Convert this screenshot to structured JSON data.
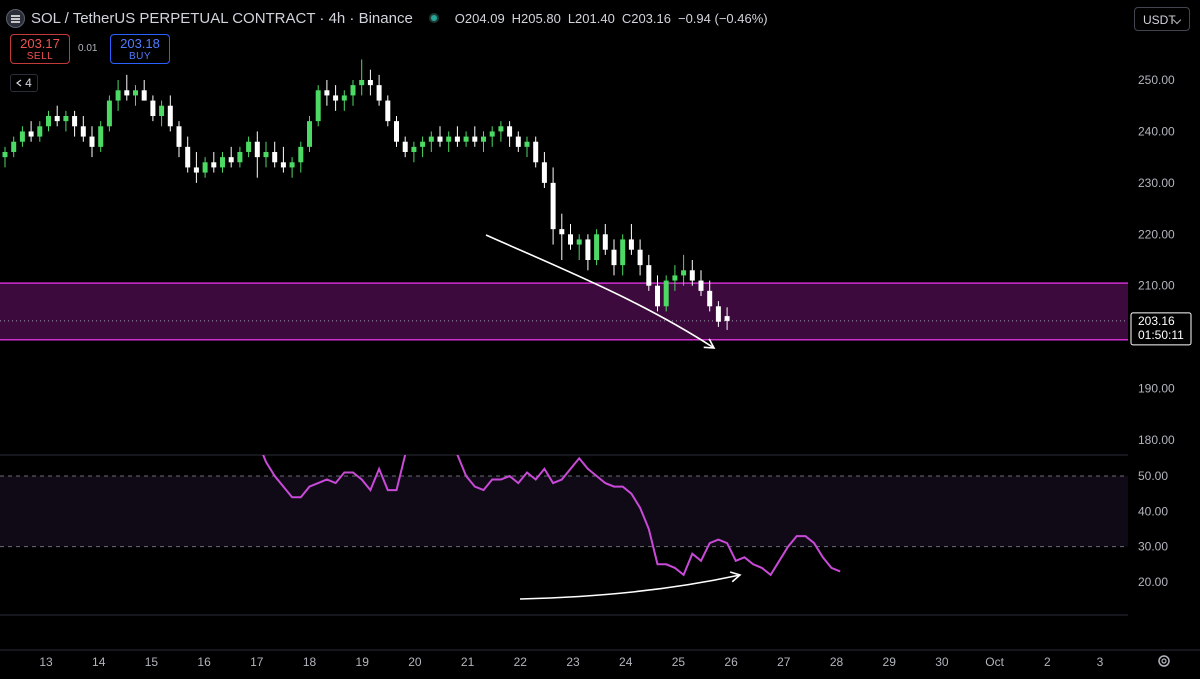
{
  "header": {
    "symbol": "SOL / TetherUS PERPETUAL CONTRACT · 4h · Binance",
    "open": "O204.09",
    "high": "H205.80",
    "low": "L201.40",
    "close": "C203.16",
    "change": "−0.94 (−0.46%)",
    "sell_price": "203.17",
    "sell_label": "SELL",
    "spread": "0.01",
    "buy_price": "203.18",
    "buy_label": "BUY",
    "collapse_count": "4",
    "currency": "USDT",
    "collapse_icon": "chevron-left-icon",
    "settings_icon": "gear-icon"
  },
  "chart_data": [
    {
      "type": "candlestick",
      "ylim": [
        175,
        255
      ],
      "yticks": [
        "250.00",
        "240.00",
        "230.00",
        "220.00",
        "210.00",
        "190.00",
        "180.00"
      ],
      "xticks": [
        "13",
        "14",
        "15",
        "16",
        "17",
        "18",
        "19",
        "20",
        "21",
        "22",
        "23",
        "24",
        "25",
        "26",
        "27",
        "28",
        "29",
        "30",
        "Oct",
        "2",
        "3"
      ],
      "last_price": "203.16",
      "countdown": "01:50:11",
      "colors": {
        "up": "#4cd964",
        "down": "#ffffff",
        "zone": "#d02fd0",
        "zone_fill": "#3c0a3c"
      },
      "zone": [
        199.5,
        210.5
      ],
      "candles": [
        [
          235,
          237,
          233,
          236
        ],
        [
          236,
          239,
          235,
          238
        ],
        [
          238,
          241,
          237,
          240
        ],
        [
          240,
          242,
          238,
          239
        ],
        [
          239,
          242,
          238,
          241
        ],
        [
          241,
          244,
          240,
          243
        ],
        [
          243,
          245,
          241,
          242
        ],
        [
          242,
          244,
          240,
          243
        ],
        [
          243,
          244,
          239,
          241
        ],
        [
          241,
          243,
          238,
          239
        ],
        [
          239,
          241,
          235,
          237
        ],
        [
          237,
          242,
          236,
          241
        ],
        [
          241,
          247,
          240,
          246
        ],
        [
          246,
          250,
          244,
          248
        ],
        [
          248,
          251,
          246,
          247
        ],
        [
          247,
          249,
          245,
          248
        ],
        [
          248,
          250,
          246,
          246
        ],
        [
          246,
          247,
          242,
          243
        ],
        [
          243,
          246,
          241,
          245
        ],
        [
          245,
          247,
          240,
          241
        ],
        [
          241,
          242,
          235,
          237
        ],
        [
          237,
          239,
          232,
          233
        ],
        [
          233,
          236,
          230,
          232
        ],
        [
          232,
          235,
          231,
          234
        ],
        [
          234,
          236,
          232,
          233
        ],
        [
          233,
          236,
          232,
          235
        ],
        [
          235,
          237,
          233,
          234
        ],
        [
          234,
          237,
          233,
          236
        ],
        [
          236,
          239,
          235,
          238
        ],
        [
          238,
          240,
          231,
          235
        ],
        [
          235,
          238,
          233,
          236
        ],
        [
          236,
          238,
          233,
          234
        ],
        [
          234,
          237,
          232,
          233
        ],
        [
          233,
          235,
          231,
          234
        ],
        [
          234,
          238,
          232,
          237
        ],
        [
          237,
          243,
          236,
          242
        ],
        [
          242,
          249,
          241,
          248
        ],
        [
          248,
          250,
          245,
          247
        ],
        [
          247,
          249,
          244,
          246
        ],
        [
          246,
          248,
          244,
          247
        ],
        [
          247,
          250,
          245,
          249
        ],
        [
          249,
          254,
          247,
          250
        ],
        [
          250,
          252,
          247,
          249
        ],
        [
          249,
          251,
          245,
          246
        ],
        [
          246,
          247,
          241,
          242
        ],
        [
          242,
          243,
          237,
          238
        ],
        [
          238,
          239,
          235,
          236
        ],
        [
          236,
          238,
          234,
          237
        ],
        [
          237,
          239,
          235,
          238
        ],
        [
          238,
          240,
          236,
          239
        ],
        [
          239,
          241,
          237,
          238
        ],
        [
          238,
          240,
          236,
          239
        ],
        [
          239,
          241,
          237,
          238
        ],
        [
          238,
          240,
          237,
          239
        ],
        [
          239,
          241,
          237,
          238
        ],
        [
          238,
          240,
          236,
          239
        ],
        [
          239,
          241,
          237,
          240
        ],
        [
          240,
          242,
          238,
          241
        ],
        [
          241,
          242,
          237,
          239
        ],
        [
          239,
          240,
          236,
          237
        ],
        [
          237,
          239,
          235,
          238
        ],
        [
          238,
          239,
          233,
          234
        ],
        [
          234,
          236,
          229,
          230
        ],
        [
          230,
          233,
          218,
          221
        ],
        [
          221,
          224,
          215,
          220
        ],
        [
          220,
          222,
          217,
          218
        ],
        [
          218,
          220,
          215,
          219
        ],
        [
          219,
          220,
          213,
          215
        ],
        [
          215,
          221,
          214,
          220
        ],
        [
          220,
          222,
          216,
          217
        ],
        [
          217,
          219,
          212,
          214
        ],
        [
          214,
          220,
          212,
          219
        ],
        [
          219,
          222,
          216,
          217
        ],
        [
          217,
          219,
          212,
          214
        ],
        [
          214,
          216,
          209,
          210
        ],
        [
          210,
          212,
          205,
          206
        ],
        [
          206,
          212,
          205,
          211
        ],
        [
          211,
          214,
          209,
          212
        ],
        [
          212,
          216,
          210,
          213
        ],
        [
          213,
          215,
          210,
          211
        ],
        [
          211,
          213,
          208,
          209
        ],
        [
          209,
          211,
          205,
          206
        ],
        [
          206,
          207,
          202,
          203
        ],
        [
          204.09,
          205.8,
          201.4,
          203.16
        ]
      ]
    },
    {
      "type": "line",
      "ylim": [
        10,
        56
      ],
      "yticks": [
        "50.00",
        "40.00",
        "30.00",
        "20.00"
      ],
      "band": [
        30,
        50
      ],
      "color": "#c94ad8",
      "start_index": 29,
      "values": [
        60,
        54,
        50,
        47,
        44,
        44,
        47,
        48,
        49,
        48,
        51,
        51,
        49,
        46,
        52,
        46,
        46,
        56,
        62,
        64,
        63,
        62,
        60,
        56,
        50,
        47,
        46,
        49,
        49,
        50,
        48,
        51,
        49,
        52,
        48,
        49,
        52,
        55,
        52,
        50,
        48,
        47,
        47,
        45,
        41,
        35,
        25,
        25,
        24,
        22,
        28,
        26,
        31,
        32,
        31,
        26,
        27,
        25,
        24,
        22,
        26,
        30,
        33,
        33,
        31,
        27,
        24,
        23
      ]
    }
  ]
}
